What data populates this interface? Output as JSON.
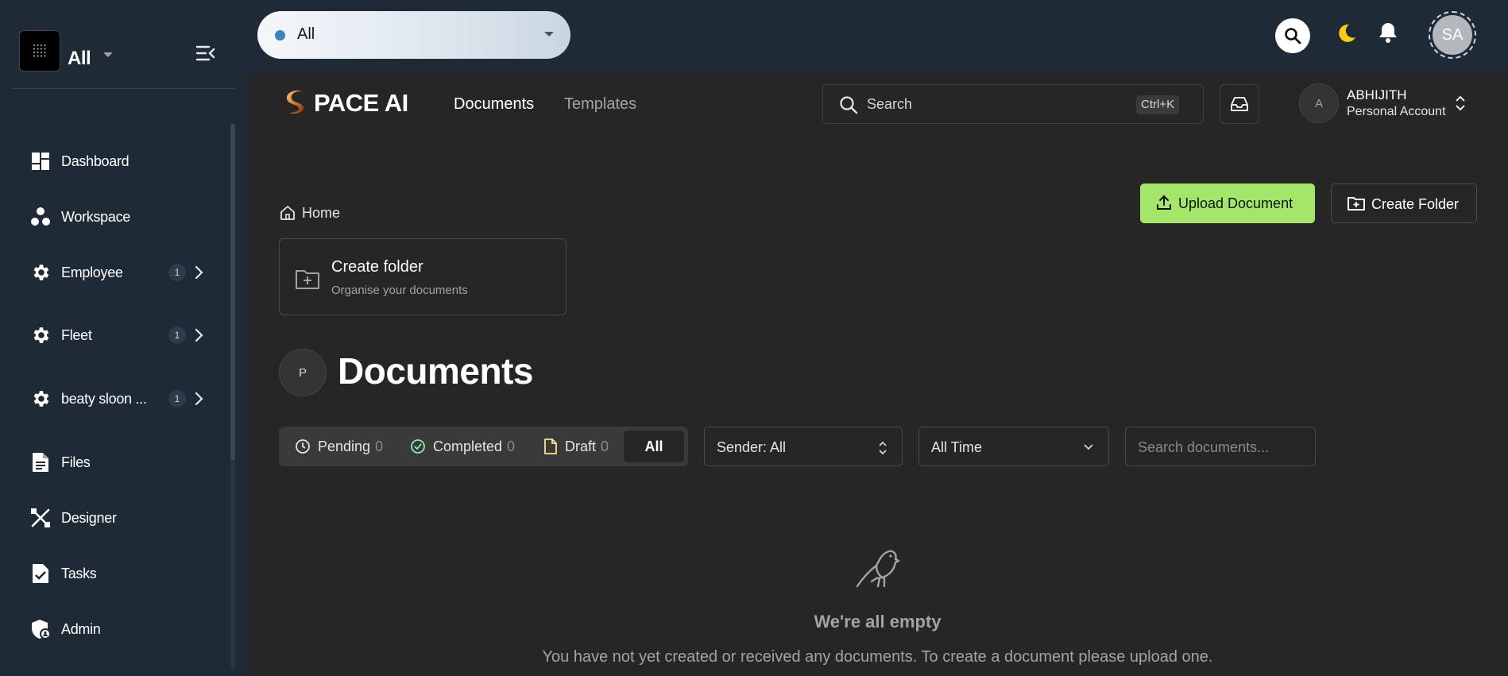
{
  "sidebar": {
    "workspace_label": "All",
    "items": [
      {
        "label": "Dashboard",
        "icon": "dashboard-icon"
      },
      {
        "label": "Workspace",
        "icon": "workspace-icon"
      },
      {
        "label": "Employee",
        "icon": "gear-icon",
        "badge": "1"
      },
      {
        "label": "Fleet",
        "icon": "gear-icon",
        "badge": "1"
      },
      {
        "label": "beaty sloon ...",
        "icon": "gear-icon",
        "badge": "1"
      },
      {
        "label": "Files",
        "icon": "file-icon"
      },
      {
        "label": "Designer",
        "icon": "designer-icon"
      },
      {
        "label": "Tasks",
        "icon": "tasks-icon"
      },
      {
        "label": "Admin",
        "icon": "admin-icon"
      }
    ]
  },
  "topbar": {
    "workspace_select": "All",
    "avatar_initials": "SA",
    "colors": {
      "dot": "#3b82c4",
      "moon": "#facc15"
    }
  },
  "app": {
    "brand": "PACE AI",
    "tabs": [
      "Documents",
      "Templates"
    ],
    "search_placeholder": "Search",
    "search_shortcut": "Ctrl+K",
    "account": {
      "initial": "A",
      "name": "ABHIJITH",
      "type": "Personal Account"
    }
  },
  "actions": {
    "upload": "Upload Document",
    "create_folder": "Create Folder",
    "accent": "#a3e66a"
  },
  "breadcrumb": {
    "home": "Home"
  },
  "folder_card": {
    "title": "Create folder",
    "subtitle": "Organise your documents"
  },
  "documents": {
    "avatar": "P",
    "title": "Documents",
    "filters": [
      {
        "label": "Pending",
        "count": "0"
      },
      {
        "label": "Completed",
        "count": "0"
      },
      {
        "label": "Draft",
        "count": "0"
      },
      {
        "label": "All"
      }
    ],
    "sender_select": "Sender: All",
    "time_select": "All Time",
    "search_placeholder": "Search documents...",
    "empty_title": "We're all empty",
    "empty_desc": "You have not yet created or received any documents. To create a document please upload one."
  }
}
